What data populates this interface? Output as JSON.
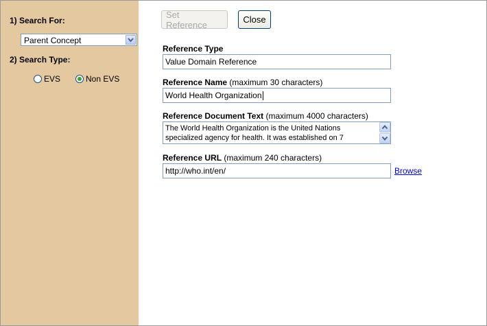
{
  "sidebar": {
    "search_for_label": "1) Search For:",
    "search_for_value": "Parent Concept",
    "search_type_label": "2) Search Type:",
    "radio_evs_label": "EVS",
    "radio_nonevs_label": "Non EVS",
    "selected_search_type": "Non EVS"
  },
  "toolbar": {
    "set_reference_label": "Set Reference",
    "close_label": "Close"
  },
  "form": {
    "ref_type_label": "Reference Type",
    "ref_type_value": "Value Domain Reference",
    "ref_name_label": "Reference Name",
    "ref_name_hint": " (maximum 30 characters)",
    "ref_name_value": "World Health Organization",
    "ref_doc_label": "Reference Document Text",
    "ref_doc_hint": " (maximum 4000 characters)",
    "ref_doc_value": "The World Health Organization is the United Nations specialized agency for health. It was established on 7",
    "ref_url_label": "Reference URL",
    "ref_url_hint": " (maximum 240 characters)",
    "ref_url_value": "http://who.int/en/",
    "browse_label": "Browse"
  },
  "colors": {
    "sidebar_bg": "#e3c8a0",
    "link": "#0000ee",
    "radio_selected": "#3fa22d"
  }
}
